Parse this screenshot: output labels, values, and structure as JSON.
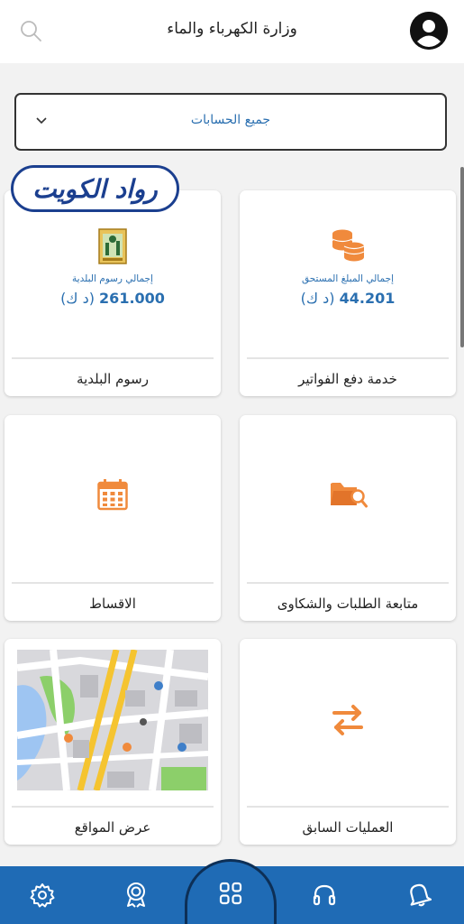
{
  "header": {
    "title": "وزارة الكهرباء والماء",
    "search_icon": "search-icon",
    "profile_icon": "profile-icon"
  },
  "account_select": {
    "value": "جميع الحسابات",
    "chevron_icon": "chevron-down-icon"
  },
  "watermark": {
    "text": "رواد الكويت",
    "color": "#1b3f8f"
  },
  "cards": {
    "bills": {
      "label": "خدمة دفع الفواتير",
      "amount_label": "إجمالي المبلغ المستحق",
      "amount": "44.201",
      "currency": "(د ك)",
      "icon": "coins-icon"
    },
    "municipality": {
      "label": "رسوم البلدية",
      "amount_label": "إجمالي رسوم البلدية",
      "amount": "261.000",
      "currency": "(د ك)",
      "icon": "municipality-emblem-icon"
    },
    "requests": {
      "label": "متابعة الطلبات والشكاوى",
      "icon": "folder-search-icon"
    },
    "installments": {
      "label": "الاقساط",
      "icon": "calendar-icon"
    },
    "transactions": {
      "label": "العمليات السابق",
      "icon": "swap-arrows-icon"
    },
    "locations": {
      "label": "عرض المواقع",
      "icon": "map-image"
    }
  },
  "bottom_nav": [
    "bell-icon",
    "headset-icon",
    "grid-icon",
    "award-icon",
    "settings-icon"
  ],
  "colors": {
    "accent": "#2a6fb0",
    "orange": "#f08a3c",
    "nav": "#1f6bb5"
  }
}
